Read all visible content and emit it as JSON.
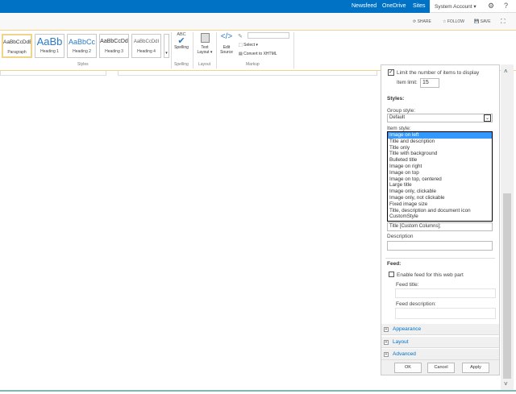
{
  "topbar": {
    "links": [
      "Newsfeed",
      "OneDrive",
      "Sites"
    ],
    "account": "System Account ▾",
    "settings_icon": "gear-icon",
    "help": "?"
  },
  "actions": {
    "share": "SHARE",
    "follow": "FOLLOW",
    "save": "SAVE"
  },
  "ribbon": {
    "styles": [
      {
        "sample": "AaBbCcDdE",
        "label": "Paragraph"
      },
      {
        "sample": "AaBb",
        "label": "Heading 1"
      },
      {
        "sample": "AaBbCc",
        "label": "Heading 2"
      },
      {
        "sample": "AaBbCcDd",
        "label": "Heading 3"
      },
      {
        "sample": "AaBbCcDdI",
        "label": "Heading 4"
      }
    ],
    "styles_group": "Styles",
    "spelling_abc": "ABC",
    "spelling": "Spelling",
    "spelling_group": "Spelling",
    "text_layout": "Text Layout ▾",
    "layout_group": "Layout",
    "edit_source": "Edit Source",
    "select": "Select ▾",
    "convert": "Convert to XHTML",
    "markup_group": "Markup"
  },
  "panel": {
    "limit_label": "Limit the number of items to display",
    "limit_checked": true,
    "item_limit_label": "Item limit:",
    "item_limit": "15",
    "styles_heading": "Styles:",
    "group_style_label": "Group style:",
    "group_style": "Default",
    "item_style_label": "Item style:",
    "item_style_options": [
      "Image on left",
      "Title and description",
      "Title only",
      "Title with background",
      "Bulleted title",
      "Image on right",
      "Image on top",
      "Image on top, centered",
      "Large title",
      "Image only, clickable",
      "Image only, not clickable",
      "Fixed image size",
      "Title, description and document icon",
      "CustomStyle"
    ],
    "item_style_selected": "Image on left",
    "title_field": "Title [Custom Columns];",
    "description_label": "Description",
    "feed_heading": "Feed:",
    "enable_feed": "Enable feed for this web part",
    "enable_feed_checked": false,
    "feed_title_label": "Feed title:",
    "feed_description_label": "Feed description:",
    "sections": [
      "Appearance",
      "Layout",
      "Advanced"
    ],
    "ok": "OK",
    "cancel": "Cancel",
    "apply": "Apply"
  }
}
